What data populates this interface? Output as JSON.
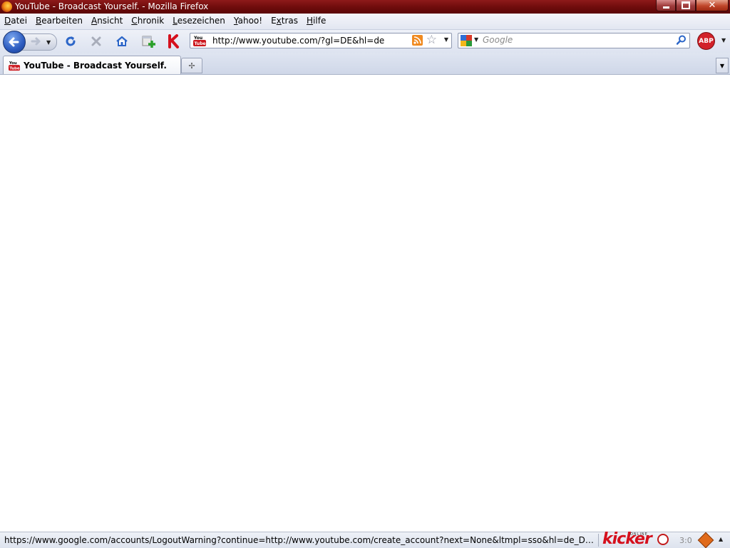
{
  "window": {
    "title": "YouTube - Broadcast Yourself. - Mozilla Firefox"
  },
  "menu": {
    "items": [
      {
        "label": "atei",
        "key": "D"
      },
      {
        "label": "earbeiten",
        "key": "B"
      },
      {
        "label": "nsicht",
        "key": "A"
      },
      {
        "label": "hronik",
        "key": "C"
      },
      {
        "label": "esezeichen",
        "key": "L"
      },
      {
        "label": "ahoo!",
        "key": "Y"
      },
      {
        "label": "tras",
        "key": "E",
        "prefix_key": "x"
      },
      {
        "label": "ilfe",
        "key": "H"
      }
    ]
  },
  "navigation": {
    "url": "http://www.youtube.com/?gl=DE&hl=de",
    "search_placeholder": "Google"
  },
  "tabs": [
    {
      "label": "YouTube - Broadcast Yourself.",
      "active": true
    }
  ],
  "status": {
    "text": "https://www.google.com/accounts/LogoutWarning?continue=http://www.youtube.com/create_account?next=None&ltmpl=sso&hl=de_DE&service=you...",
    "kicker_logo": "kicker",
    "kicker_sub": "ONLINE",
    "score": "3:0"
  },
  "colors": {
    "titlebar": "#7a1010",
    "accent_blue": "#2c5bbf",
    "abp_red": "#d2222a",
    "kicker_red": "#d5101d"
  },
  "icons": {
    "back": "back-arrow-icon",
    "forward": "forward-arrow-icon",
    "reload": "reload-icon",
    "stop": "stop-icon",
    "home": "home-icon",
    "add_bookmark": "add-bookmark-icon",
    "kicker": "kicker-icon",
    "rss": "rss-feed-icon",
    "star": "bookmark-star-icon",
    "search": "search-magnifier-icon",
    "adblock": "adblock-plus-icon"
  }
}
